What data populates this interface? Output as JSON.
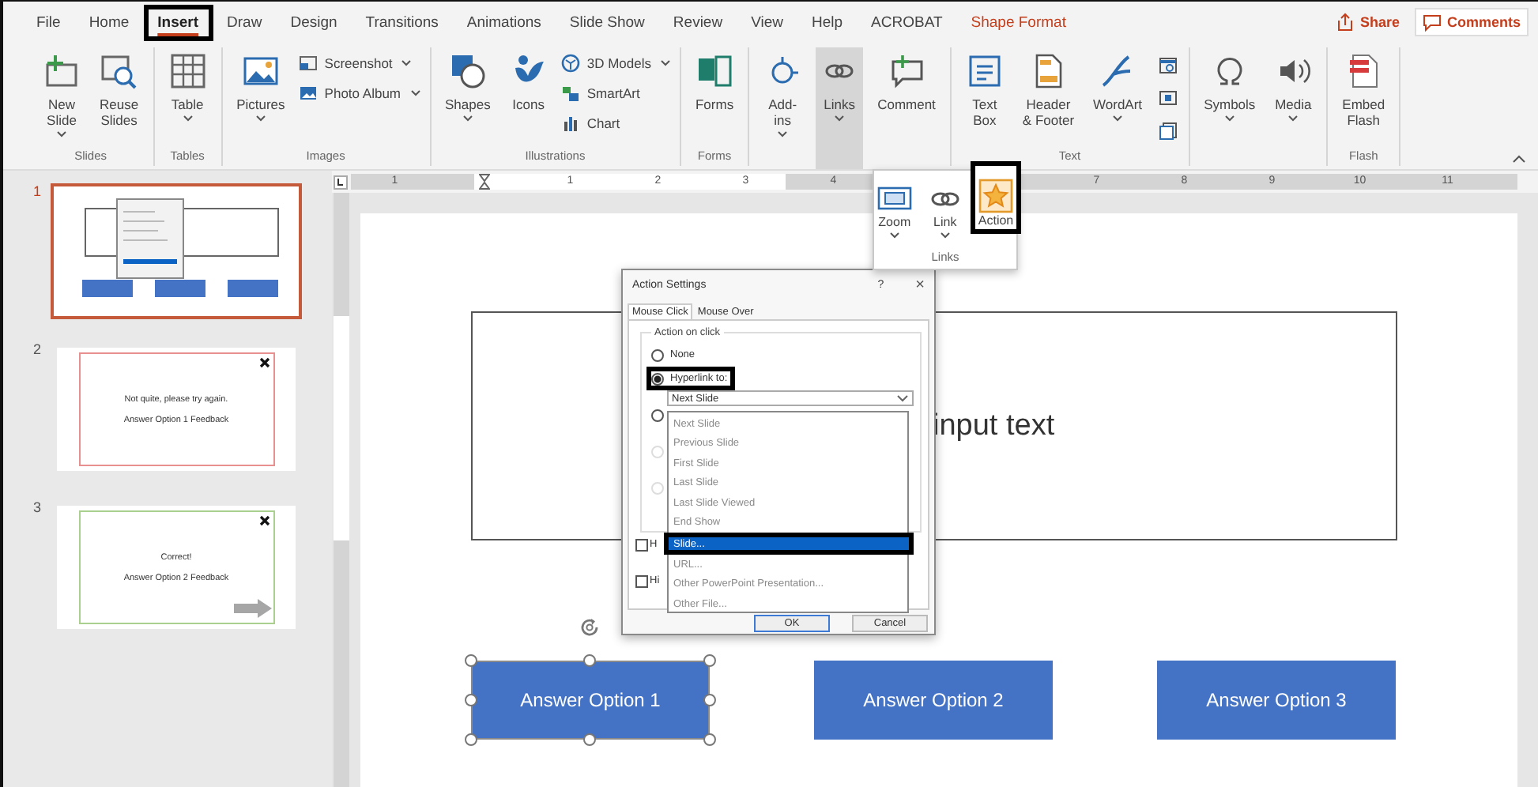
{
  "tabs": [
    {
      "label": "File",
      "selected": false,
      "annotated": false,
      "kind": "tab"
    },
    {
      "label": "Home",
      "selected": false,
      "annotated": false,
      "kind": "tab"
    },
    {
      "label": "Insert",
      "selected": true,
      "annotated": true,
      "kind": "tab"
    },
    {
      "label": "Draw",
      "selected": false,
      "annotated": false,
      "kind": "tab"
    },
    {
      "label": "Design",
      "selected": false,
      "annotated": false,
      "kind": "tab"
    },
    {
      "label": "Transitions",
      "selected": false,
      "annotated": false,
      "kind": "tab"
    },
    {
      "label": "Animations",
      "selected": false,
      "annotated": false,
      "kind": "tab"
    },
    {
      "label": "Slide Show",
      "selected": false,
      "annotated": false,
      "kind": "tab"
    },
    {
      "label": "Review",
      "selected": false,
      "annotated": false,
      "kind": "tab"
    },
    {
      "label": "View",
      "selected": false,
      "annotated": false,
      "kind": "tab"
    },
    {
      "label": "Help",
      "selected": false,
      "annotated": false,
      "kind": "tab"
    },
    {
      "label": "ACROBAT",
      "selected": false,
      "annotated": false,
      "kind": "tab"
    },
    {
      "label": "Shape Format",
      "selected": false,
      "annotated": false,
      "kind": "contextual"
    }
  ],
  "header_buttons": [
    {
      "label": "Share",
      "kind": "share"
    },
    {
      "label": "Comments",
      "kind": "comments"
    }
  ],
  "ribbon": {
    "groups": [
      {
        "label": "Slides",
        "buttons": [
          {
            "kind": "large",
            "label": "New\nSlide",
            "dropdown": true,
            "open": false
          },
          {
            "kind": "large",
            "label": "Reuse\nSlides",
            "dropdown": false,
            "open": false
          }
        ]
      },
      {
        "label": "Tables",
        "buttons": [
          {
            "kind": "large",
            "label": "Table",
            "dropdown": true,
            "open": false
          }
        ]
      },
      {
        "label": "Images",
        "buttons": [
          {
            "kind": "large",
            "label": "Pictures",
            "dropdown": true,
            "open": false
          },
          {
            "kind": "small",
            "label": "Screenshot",
            "dropdown": true,
            "open": false
          },
          {
            "kind": "small",
            "label": "Photo Album",
            "dropdown": true,
            "open": false
          }
        ]
      },
      {
        "label": "Illustrations",
        "buttons": [
          {
            "kind": "large",
            "label": "Shapes",
            "dropdown": true,
            "open": false
          },
          {
            "kind": "large",
            "label": "Icons",
            "dropdown": false,
            "open": false
          },
          {
            "kind": "small",
            "label": "3D Models",
            "dropdown": true,
            "open": false
          },
          {
            "kind": "small",
            "label": "SmartArt",
            "dropdown": false,
            "open": false
          },
          {
            "kind": "small",
            "label": "Chart",
            "dropdown": false,
            "open": false
          }
        ]
      },
      {
        "label": "Forms",
        "buttons": [
          {
            "kind": "large",
            "label": "Forms",
            "dropdown": false,
            "open": false
          }
        ]
      },
      {
        "buttons": [
          {
            "kind": "large",
            "label": "Add-\nins",
            "dropdown": true,
            "open": false
          },
          {
            "kind": "large",
            "label": "Links",
            "dropdown": true,
            "open": true
          },
          {
            "kind": "large",
            "label": "Comment",
            "dropdown": false,
            "open": false
          }
        ]
      },
      {
        "label": "Text",
        "buttons": [
          {
            "kind": "large",
            "label": "Text\nBox",
            "dropdown": false,
            "open": false
          },
          {
            "kind": "large",
            "label": "Header\n& Footer",
            "dropdown": false,
            "open": false
          },
          {
            "kind": "large",
            "label": "WordArt",
            "dropdown": true,
            "open": false
          },
          {
            "kind": "icon",
            "dropdown": false,
            "open": false
          },
          {
            "kind": "icon",
            "dropdown": false,
            "open": false
          },
          {
            "kind": "icon",
            "dropdown": false,
            "open": false
          }
        ]
      },
      {
        "buttons": [
          {
            "kind": "large",
            "label": "Symbols",
            "dropdown": true,
            "open": false
          },
          {
            "kind": "large",
            "label": "Media",
            "dropdown": true,
            "open": false
          }
        ]
      },
      {
        "label": "Flash",
        "buttons": [
          {
            "kind": "large",
            "label": "Embed\nFlash",
            "dropdown": false,
            "open": false
          }
        ]
      }
    ]
  },
  "links_menu": {
    "label": "Links",
    "items": [
      {
        "label": "Zoom",
        "dropdown": true,
        "annotated": false
      },
      {
        "label": "Link",
        "dropdown": true,
        "annotated": false
      },
      {
        "label": "Action",
        "dropdown": false,
        "annotated": true
      }
    ]
  },
  "ruler": [
    "1",
    "1",
    "2",
    "3",
    "4",
    "7",
    "8",
    "9",
    "10",
    "11"
  ],
  "slides": [
    {
      "number": "1",
      "selected": true,
      "kind": "question"
    },
    {
      "number": "2",
      "selected": false,
      "kind": "feedback",
      "color": "#e88f8f",
      "lines": [
        "Not quite, please try again.",
        "Answer Option 1 Feedback"
      ],
      "next": false
    },
    {
      "number": "3",
      "selected": false,
      "kind": "feedback",
      "color": "#a9d08e",
      "lines": [
        "Correct!",
        "Answer Option 2 Feedback"
      ],
      "next": true
    }
  ],
  "slide": {
    "text_box": "input text",
    "answers": [
      {
        "label": "Answer Option 1",
        "selected": true
      },
      {
        "label": "Answer Option 2",
        "selected": false
      },
      {
        "label": "Answer Option 3",
        "selected": false
      }
    ]
  },
  "dialog": {
    "title": "Action Settings",
    "help": "?",
    "close": "×",
    "tabs": [
      {
        "label": "Mouse Click",
        "selected": true
      },
      {
        "label": "Mouse Over",
        "selected": false
      }
    ],
    "group": "Action on click",
    "options": [
      {
        "label": "None",
        "checked": false,
        "disabled": false,
        "annotated": false
      },
      {
        "label": "Hyperlink to:",
        "checked": true,
        "disabled": false,
        "annotated": true
      }
    ],
    "target": "Next Slide",
    "other_options": [
      {
        "checked": false,
        "disabled": false
      },
      {
        "checked": false,
        "disabled": true
      },
      {
        "checked": false,
        "disabled": true
      }
    ],
    "list": [
      {
        "label": "Next Slide",
        "selected": false,
        "annotated": false
      },
      {
        "label": "Previous Slide",
        "selected": false,
        "annotated": false
      },
      {
        "label": "First Slide",
        "selected": false,
        "annotated": false
      },
      {
        "label": "Last Slide",
        "selected": false,
        "annotated": false
      },
      {
        "label": "Last Slide Viewed",
        "selected": false,
        "annotated": false
      },
      {
        "label": "End Show",
        "selected": false,
        "annotated": false
      },
      {
        "label": "Slide...",
        "selected": true,
        "annotated": true
      },
      {
        "label": "URL...",
        "selected": false,
        "annotated": false
      },
      {
        "label": "Other PowerPoint Presentation...",
        "selected": false,
        "annotated": false
      },
      {
        "label": "Other File...",
        "selected": false,
        "annotated": false
      }
    ],
    "checkboxes": [
      {
        "label": "H",
        "checked": false
      },
      {
        "label": "Hi",
        "checked": false
      }
    ],
    "buttons": [
      "OK",
      "Cancel"
    ]
  }
}
